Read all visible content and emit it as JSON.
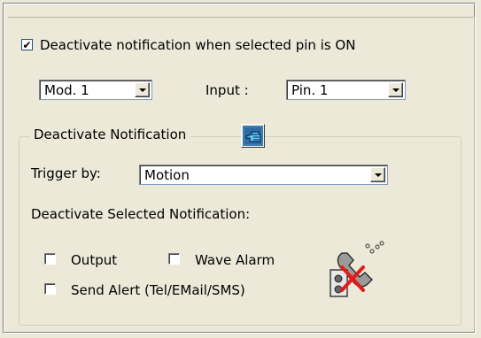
{
  "deactivate_checkbox": {
    "label": "Deactivate notification when selected pin is ON",
    "checked": true
  },
  "module_select": {
    "value": "Mod. 1"
  },
  "input_label": "Input :",
  "pin_select": {
    "value": "Pin. 1"
  },
  "group": {
    "title": "Deactivate Notification",
    "icon": "hand-pointer-icon",
    "trigger_label": "Trigger by:",
    "trigger_select": {
      "value": "Motion"
    },
    "selected_notification_label": "Deactivate Selected Notification:",
    "options": {
      "output": {
        "label": "Output",
        "checked": false
      },
      "wave_alarm": {
        "label": "Wave Alarm",
        "checked": false
      },
      "send_alert": {
        "label": "Send Alert (Tel/EMail/SMS)",
        "checked": false
      }
    },
    "phone_icon": "phone-disabled-icon"
  }
}
